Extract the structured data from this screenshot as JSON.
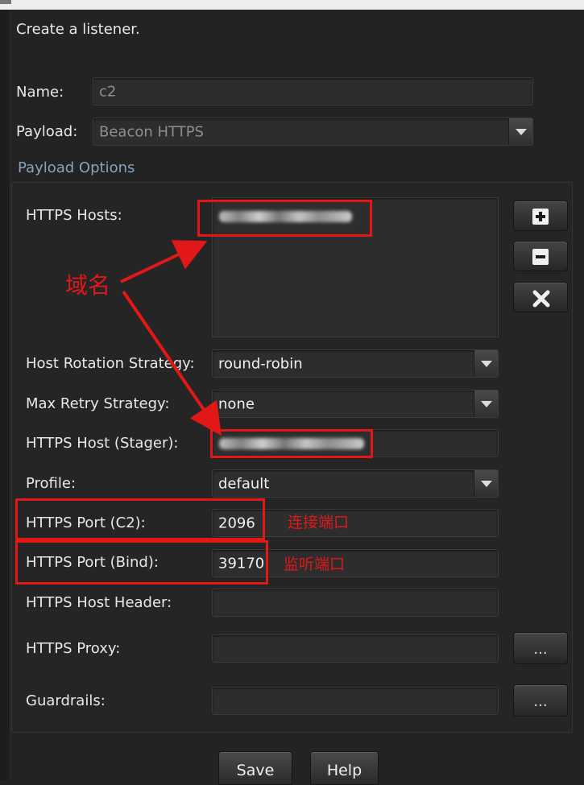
{
  "dialog": {
    "heading": "Create a listener.",
    "name_label": "Name:",
    "name_value": "c2",
    "payload_label": "Payload:",
    "payload_value": "Beacon HTTPS",
    "section_title": "Payload Options"
  },
  "options": {
    "https_hosts_label": "HTTPS Hosts:",
    "host_rotation_label": "Host Rotation Strategy:",
    "host_rotation_value": "round-robin",
    "max_retry_label": "Max Retry Strategy:",
    "max_retry_value": "none",
    "stager_label": "HTTPS Host (Stager):",
    "profile_label": "Profile:",
    "profile_value": "default",
    "port_c2_label": "HTTPS Port (C2):",
    "port_c2_value": "2096",
    "port_bind_label": "HTTPS Port (Bind):",
    "port_bind_value": "39170",
    "host_header_label": "HTTPS Host Header:",
    "proxy_label": "HTTPS Proxy:",
    "guardrails_label": "Guardrails:",
    "ellipsis": "..."
  },
  "annotations": {
    "domain": "域名",
    "connect_port": "连接端口",
    "listen_port": "监听端口",
    "color": "#e21818"
  },
  "buttons": {
    "save": "Save",
    "help": "Help"
  },
  "icons": [
    "plus-icon",
    "minus-icon",
    "close-x-icon",
    "chevron-down-icon"
  ]
}
